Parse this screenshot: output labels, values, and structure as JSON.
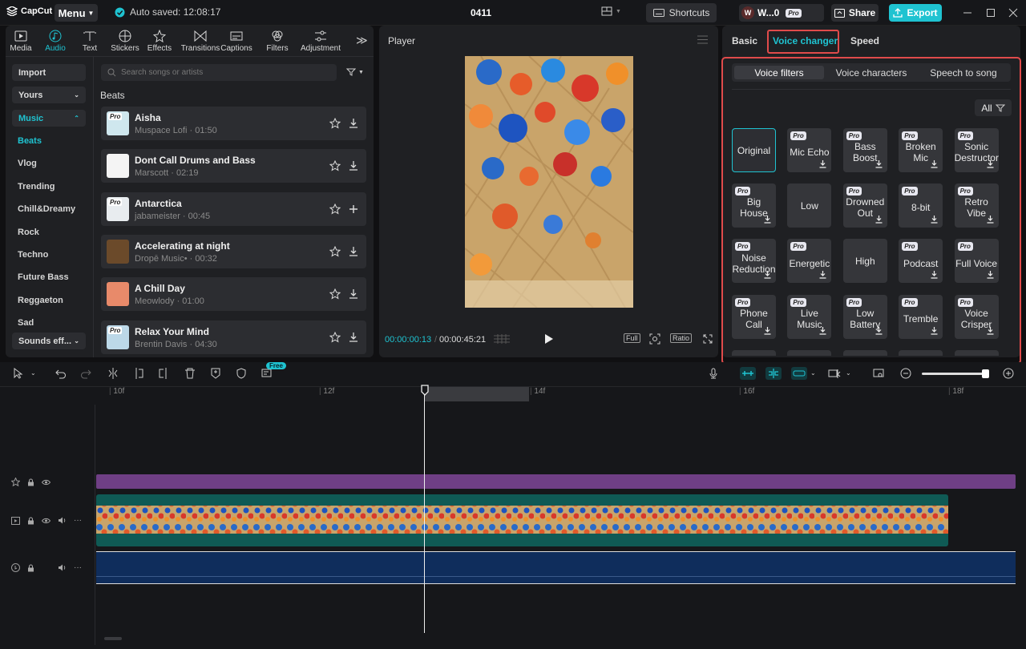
{
  "app": {
    "name": "CapCut",
    "menu_label": "Menu",
    "autosave": "Auto saved: 12:08:17",
    "project_title": "0411",
    "shortcuts": "Shortcuts",
    "user_short": "W...0",
    "user_initial": "W",
    "pro": "Pro",
    "share": "Share",
    "export": "Export"
  },
  "toolbar_tabs": [
    {
      "label": "Media",
      "icon": "media-icon"
    },
    {
      "label": "Audio",
      "icon": "audio-icon"
    },
    {
      "label": "Text",
      "icon": "text-icon"
    },
    {
      "label": "Stickers",
      "icon": "stickers-icon"
    },
    {
      "label": "Effects",
      "icon": "effects-icon"
    },
    {
      "label": "Transitions",
      "icon": "transitions-icon"
    },
    {
      "label": "Captions",
      "icon": "captions-icon"
    },
    {
      "label": "Filters",
      "icon": "filters-icon"
    },
    {
      "label": "Adjustment",
      "icon": "adjustment-icon"
    }
  ],
  "sidebar": {
    "import": "Import",
    "yours": "Yours",
    "music": "Music",
    "items": [
      "Beats",
      "Vlog",
      "Trending",
      "Chill&Dreamy",
      "Rock",
      "Techno",
      "Future Bass",
      "Reggaeton",
      "Sad"
    ],
    "sounds": "Sounds eff..."
  },
  "search": {
    "placeholder": "Search songs or artists"
  },
  "section_title": "Beats",
  "songs": [
    {
      "title": "Aisha",
      "meta": "Muspace Lofi · 01:50",
      "pro": true,
      "action": "download"
    },
    {
      "title": "Dont Call Drums and Bass",
      "meta": "Marscott · 02:19",
      "pro": false,
      "action": "download"
    },
    {
      "title": "Antarctica",
      "meta": "jabameister · 00:45",
      "pro": true,
      "action": "add"
    },
    {
      "title": "Accelerating at night",
      "meta": "Dropē Music• · 00:32",
      "pro": false,
      "action": "download"
    },
    {
      "title": "A Chill Day",
      "meta": "Meowlody · 01:00",
      "pro": false,
      "action": "download"
    },
    {
      "title": "Relax Your Mind",
      "meta": "Brentin Davis · 04:30",
      "pro": true,
      "action": "download"
    }
  ],
  "player": {
    "title": "Player",
    "current_time": "00:00:00:13",
    "total_time": "00:00:45:21",
    "full": "Full",
    "ratio": "Ratio"
  },
  "right": {
    "tabs": [
      "Basic",
      "Voice changer",
      "Speed"
    ],
    "subtabs": [
      "Voice filters",
      "Voice characters",
      "Speech to song"
    ],
    "all": "All",
    "filters": [
      {
        "label": "Original",
        "pro": false,
        "dl": false,
        "selected": true
      },
      {
        "label": "Mic Echo",
        "pro": true,
        "dl": true
      },
      {
        "label": "Bass Boost",
        "pro": true,
        "dl": true
      },
      {
        "label": "Broken Mic",
        "pro": true,
        "dl": true
      },
      {
        "label": "Sonic Destructor",
        "pro": true,
        "dl": true
      },
      {
        "label": "Big House",
        "pro": true,
        "dl": true
      },
      {
        "label": "Low",
        "pro": false,
        "dl": false
      },
      {
        "label": "Drowned Out",
        "pro": true,
        "dl": true
      },
      {
        "label": "8-bit",
        "pro": true,
        "dl": true
      },
      {
        "label": "Retro Vibe",
        "pro": true,
        "dl": true
      },
      {
        "label": "Noise Reduction",
        "pro": true,
        "dl": true
      },
      {
        "label": "Energetic",
        "pro": true,
        "dl": true
      },
      {
        "label": "High",
        "pro": false,
        "dl": false
      },
      {
        "label": "Podcast",
        "pro": true,
        "dl": true
      },
      {
        "label": "Full Voice",
        "pro": true,
        "dl": true
      },
      {
        "label": "Phone Call",
        "pro": true,
        "dl": true
      },
      {
        "label": "Live Music",
        "pro": true,
        "dl": true
      },
      {
        "label": "Low Battery",
        "pro": true,
        "dl": true
      },
      {
        "label": "Tremble",
        "pro": true,
        "dl": true
      },
      {
        "label": "Voice Crisper",
        "pro": true,
        "dl": true
      }
    ]
  },
  "timeline": {
    "free_badge": "Free",
    "ruler": [
      "10f",
      "12f",
      "14f",
      "16f",
      "18f"
    ],
    "colors": {
      "effect_track": "#6f3f85",
      "video_track": "#0f5a55",
      "audio_track": "#0f2d5c",
      "accent": "#1fc3d1"
    }
  }
}
